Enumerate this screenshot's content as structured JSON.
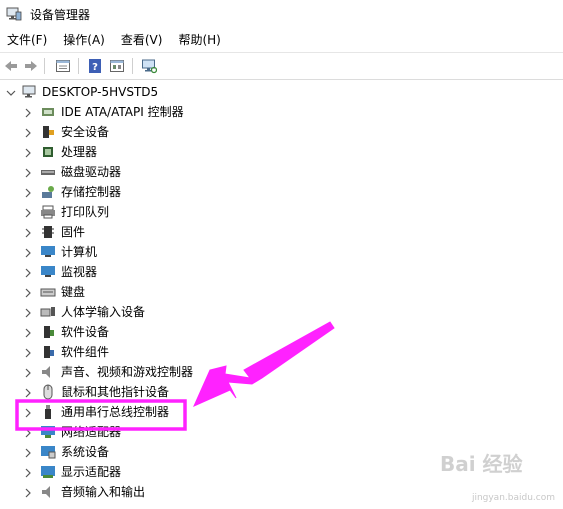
{
  "window": {
    "title": "设备管理器"
  },
  "menu": [
    "文件(F)",
    "操作(A)",
    "查看(V)",
    "帮助(H)"
  ],
  "toolbar": [
    "back-icon",
    "forward-icon",
    "properties-icon",
    "help-icon",
    "update-driver-icon",
    "scan-hardware-icon"
  ],
  "tree": {
    "root": "DESKTOP-5HVSTD5",
    "items": [
      {
        "label": "IDE ATA/ATAPI 控制器",
        "icon": "ide-controller-icon"
      },
      {
        "label": "安全设备",
        "icon": "security-device-icon"
      },
      {
        "label": "处理器",
        "icon": "processor-icon"
      },
      {
        "label": "磁盘驱动器",
        "icon": "disk-drive-icon"
      },
      {
        "label": "存储控制器",
        "icon": "storage-controller-icon"
      },
      {
        "label": "打印队列",
        "icon": "print-queue-icon"
      },
      {
        "label": "固件",
        "icon": "firmware-icon"
      },
      {
        "label": "计算机",
        "icon": "computer-icon"
      },
      {
        "label": "监视器",
        "icon": "monitor-icon"
      },
      {
        "label": "键盘",
        "icon": "keyboard-icon"
      },
      {
        "label": "人体学输入设备",
        "icon": "hid-icon"
      },
      {
        "label": "软件设备",
        "icon": "software-device-icon"
      },
      {
        "label": "软件组件",
        "icon": "software-component-icon"
      },
      {
        "label": "声音、视频和游戏控制器",
        "icon": "sound-icon"
      },
      {
        "label": "鼠标和其他指针设备",
        "icon": "mouse-icon"
      },
      {
        "label": "通用串行总线控制器",
        "icon": "usb-icon"
      },
      {
        "label": "网络适配器",
        "icon": "network-adapter-icon"
      },
      {
        "label": "系统设备",
        "icon": "system-device-icon"
      },
      {
        "label": "显示适配器",
        "icon": "display-adapter-icon"
      },
      {
        "label": "音频输入和输出",
        "icon": "audio-io-icon"
      }
    ]
  },
  "annotation": {
    "color": "#ff22ff",
    "highlighted_item": "通用串行总线控制器"
  },
  "watermark": {
    "logo": "Bai 经验",
    "url": "jingyan.baidu.com"
  }
}
